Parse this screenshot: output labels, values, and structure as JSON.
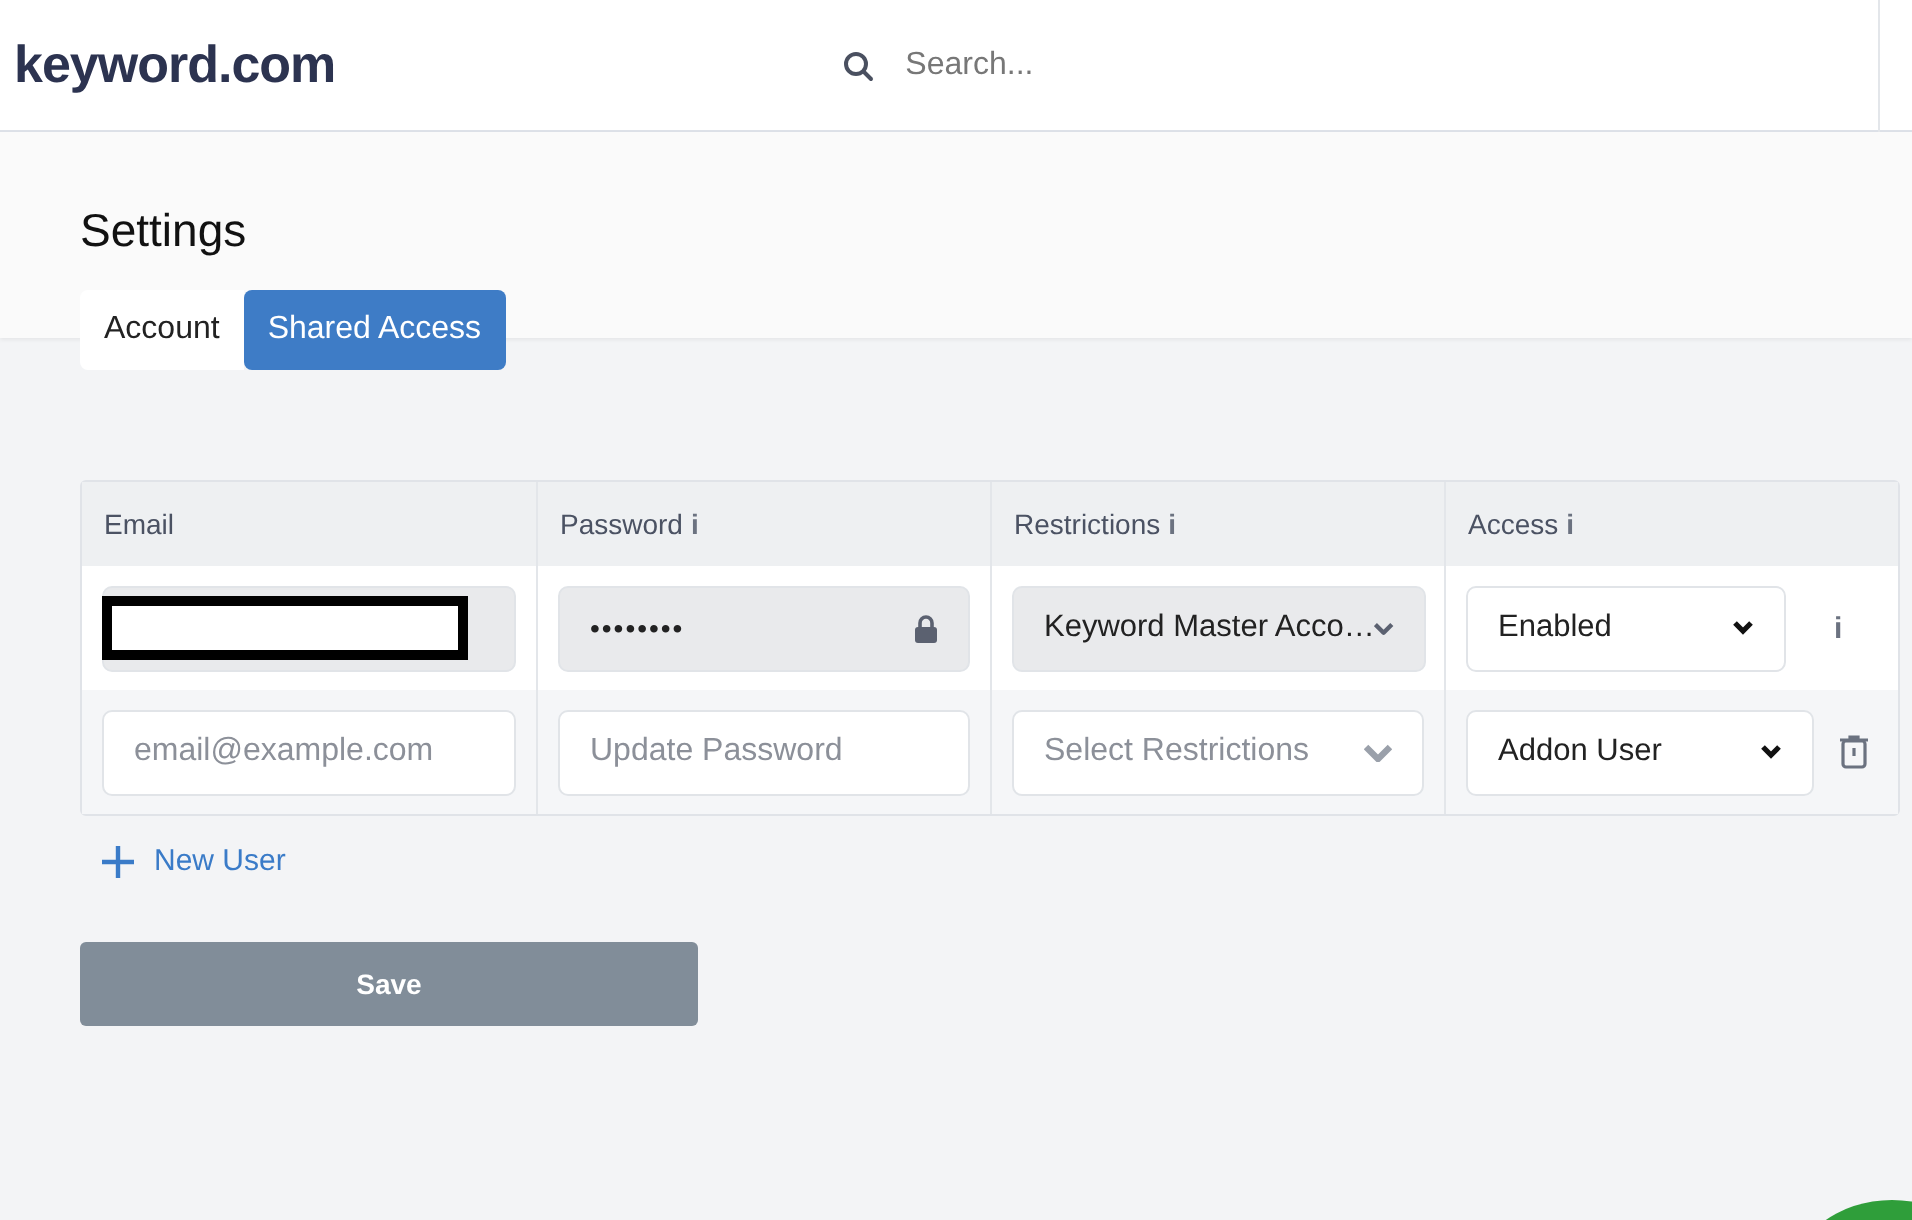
{
  "header": {
    "logo": "keyword.com",
    "search": {
      "placeholder": "Search..."
    }
  },
  "page": {
    "title": "Settings"
  },
  "tabs": [
    {
      "label": "Account",
      "selected": false
    },
    {
      "label": "Shared Access",
      "selected": true
    }
  ],
  "table": {
    "columns": [
      {
        "label": "Email"
      },
      {
        "label": "Password",
        "info": "i"
      },
      {
        "label": "Restrictions",
        "info": "i"
      },
      {
        "label": "Access",
        "info": "i"
      }
    ],
    "rows": [
      {
        "email": {
          "redacted": true,
          "disabled": true
        },
        "password": {
          "value": "••••••••",
          "disabled": true
        },
        "restrictions": {
          "value": "Keyword Master Acco…",
          "disabled": true
        },
        "access": {
          "value": "Enabled"
        },
        "action": {
          "kind": "info",
          "text": "i"
        }
      },
      {
        "email": {
          "placeholder": "email@example.com",
          "redacted": false,
          "disabled": false
        },
        "password": {
          "placeholder": "Update Password",
          "disabled": false
        },
        "restrictions": {
          "placeholder": "Select Restrictions",
          "disabled": false
        },
        "access": {
          "value": "Addon User"
        },
        "action": {
          "kind": "delete"
        }
      }
    ]
  },
  "new_user": "New User",
  "save": "Save"
}
